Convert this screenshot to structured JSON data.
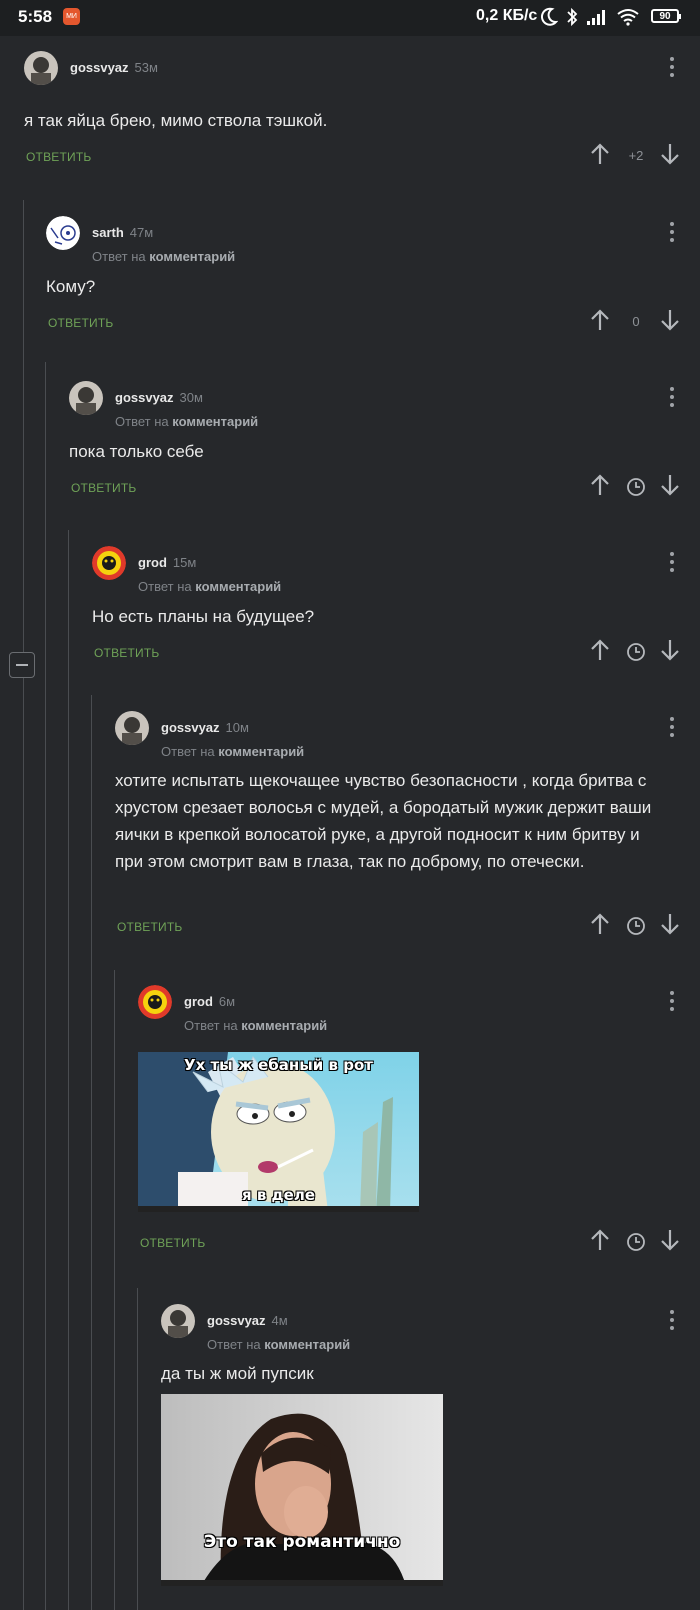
{
  "status": {
    "time": "5:58",
    "app_icon_text": "МИ",
    "speed": "0,2 КБ/с",
    "battery": "90"
  },
  "comments": [
    {
      "author": "gossvyaz",
      "age": "53м",
      "reply_to": null,
      "text": "я так яйца брею, мимо ствола тэшкой.",
      "reply_label": "ОТВЕТИТЬ",
      "score": "+2"
    },
    {
      "author": "sarth",
      "age": "47м",
      "reply_to_prefix": "Ответ на",
      "reply_to": "комментарий",
      "text": "Кому?",
      "reply_label": "ОТВЕТИТЬ",
      "score": "0"
    },
    {
      "author": "gossvyaz",
      "age": "30м",
      "reply_to_prefix": "Ответ на",
      "reply_to": "комментарий",
      "text": "пока только себе",
      "reply_label": "ОТВЕТИТЬ"
    },
    {
      "author": "grod",
      "age": "15м",
      "reply_to_prefix": "Ответ на",
      "reply_to": "комментарий",
      "text": "Но есть планы на будущее?",
      "reply_label": "ОТВЕТИТЬ"
    },
    {
      "author": "gossvyaz",
      "age": "10м",
      "reply_to_prefix": "Ответ на",
      "reply_to": "комментарий",
      "text": "хотите испытать щекочащее чувство безопасности , когда бритва с хрустом срезает волосья с мудей, а бородатый мужик держит ваши яички в крепкой волосатой руке, а другой подносит к ним бритву и при этом смотрит вам в глаза, так по доброму, по отечески.",
      "reply_label": "ОТВЕТИТЬ"
    },
    {
      "author": "grod",
      "age": "6м",
      "reply_to_prefix": "Ответ на",
      "reply_to": "комментарий",
      "meme_top": "Ух ты ж ебаный в рот",
      "meme_bottom": "я в деле",
      "reply_label": "ОТВЕТИТЬ"
    },
    {
      "author": "gossvyaz",
      "age": "4м",
      "reply_to_prefix": "Ответ на",
      "reply_to": "комментарий",
      "text": "да ты ж мой пупсик",
      "meme_bottom": "Это так романтично"
    }
  ],
  "icons": {
    "upvote": "arrow-up-icon",
    "downvote": "arrow-down-icon",
    "pending": "clock-icon",
    "menu": "kebab-icon",
    "collapse": "minus-icon"
  },
  "colors": {
    "background": "#26282b",
    "reply_link": "#6fa257",
    "thread_line": "#4a4d51"
  }
}
